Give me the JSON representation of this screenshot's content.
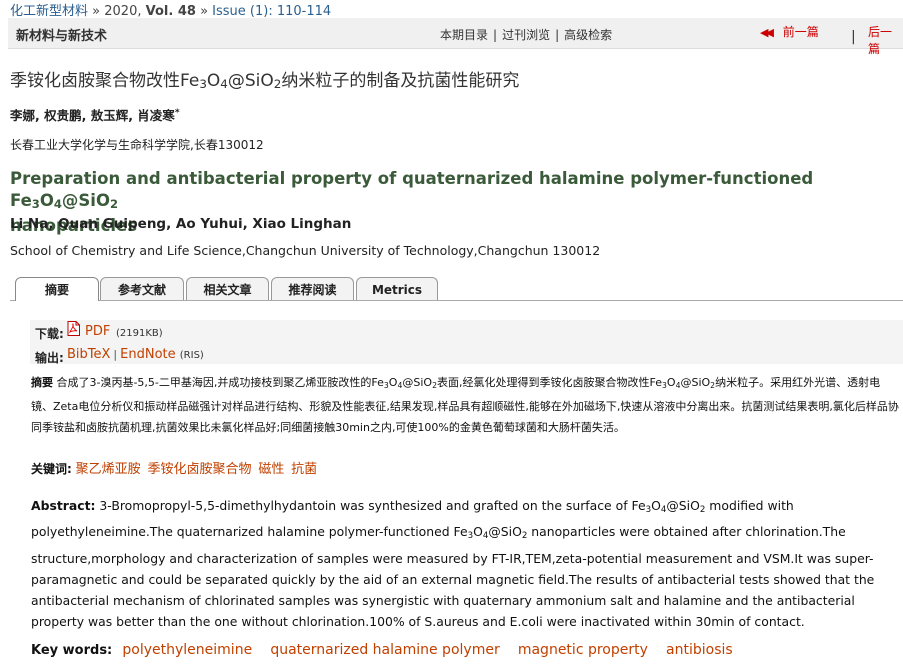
{
  "header": {
    "journal": "化工新型材料",
    "sep1": "»",
    "year": "2020,",
    "volume": "Vol. 48",
    "sep2": "»",
    "issue": "Issue (1): 110-114"
  },
  "navbar": {
    "section": "新材料与新技术",
    "links": [
      "本期目录",
      "过刊浏览",
      "高级检索"
    ],
    "prev_label": "前一篇",
    "next_label": "后一篇",
    "divider": "|"
  },
  "article": {
    "cn_title_a": "季铵化卤胺聚合物改性Fe",
    "cn_title_s1": "3",
    "cn_title_b": "O",
    "cn_title_s2": "4",
    "cn_title_c": "@Si",
    "cn_title_d": "O",
    "cn_title_s3": "2",
    "cn_title_e": "纳米粒子的制备及抗菌性能研究",
    "cn_authors": "李娜, 权贵鹏, 敖玉辉, 肖凌寒",
    "cn_authors_mark": "*",
    "cn_affiliation": "长春工业大学化学与生命科学学院,长春130012",
    "en_title_a": "Preparation and antibacterial property of quaternarized halamine polymer-functioned Fe",
    "en_title_s1": "3",
    "en_title_b": "O",
    "en_title_s2": "4",
    "en_title_c": "@SiO",
    "en_title_s3": "2",
    "en_title_d": "nanoparticles",
    "en_authors": "Li Na, Quan Guipeng, Ao Yuhui, Xiao Linghan",
    "en_affiliation": "School of Chemistry and Life Science,Changchun University of Technology,Changchun 130012"
  },
  "tabs": [
    "摘要",
    "参考文献",
    "相关文章",
    "推荐阅读",
    "Metrics"
  ],
  "download": {
    "label": "下载:",
    "pdf": "PDF",
    "size": "(2191KB)",
    "export_label": "输出:",
    "bibtex": "BibTeX",
    "sep": "|",
    "endnote": "EndNote",
    "ris": "(RIS)"
  },
  "cn_abstract": {
    "label": "摘要",
    "p1": "合成了3-溴丙基-5,5-二甲基海因,并成功接枝到聚乙烯亚胺改性的Fe",
    "s1": "3",
    "p2": "O",
    "s2": "4",
    "p3": "@SiO",
    "s3": "2",
    "p4": "表面,经氯化处理得到季铵化卤胺聚合物改性Fe",
    "s4": "3",
    "p5": "O",
    "s5": "4",
    "p6": "@SiO",
    "s6": "2",
    "p7": "纳米粒子。采用红外光谱、透射电镜、Zeta电位分析仪和振动样品磁强计对样品进行结构、形貌及性能表征,结果发现,样品具有超顺磁性,能够在外加磁场下,快速从溶液中分离出来。抗菌测试结果表明,氯化后样品协同季铵盐和卤胺抗菌机理,抗菌效果比未氯化样品好;同细菌接触30min之内,可使100%的金黄色葡萄球菌和大肠杆菌失活。"
  },
  "cn_keywords": {
    "label": "关键词:",
    "items": [
      "聚乙烯亚胺",
      "季铵化卤胺聚合物",
      "磁性",
      "抗菌"
    ]
  },
  "en_abstract": {
    "label": "Abstract:",
    "p1": "3-Bromopropyl-5,5-dimethylhydantoin was synthesized and grafted on the surface of Fe",
    "s1": "3",
    "p2": "O",
    "s2": "4",
    "p3": "@SiO",
    "s3": "2",
    "p4": "modified with polyethyleneimine.The quaternarized halamine polymer-functioned Fe",
    "s4": "3",
    "p5": "O",
    "s5": "4",
    "p6": "@SiO",
    "s6": "2",
    "p7": "nanoparticles were obtained after chlorination.The structure,morphology and characterization of samples were measured by FT-IR,TEM,zeta-potential measurement and VSM.It was super-paramagnetic and could be separated quickly by the aid of an external magnetic field.The results of antibacterial tests showed that the antibacterial mechanism of chlorinated samples was synergistic with quaternary ammonium salt and halamine and the antibacterial property was better than the one without chlorination.100% of S.aureus and E.coli were inactivated within 30min of contact."
  },
  "en_keywords": {
    "label": "Key words:",
    "items": [
      "polyethyleneimine",
      "quaternarized halamine polymer",
      "magnetic property",
      "antibiosis"
    ]
  },
  "colors": {
    "link": "#2a5f8f",
    "accent": "#c04000",
    "nav_arrow": "#cc0000",
    "en_title": "#3a5a3a"
  }
}
